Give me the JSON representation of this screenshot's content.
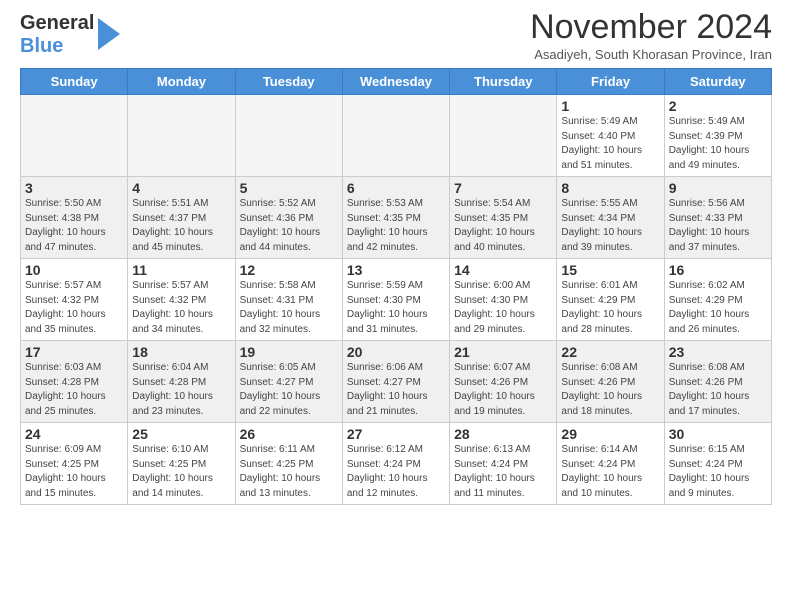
{
  "header": {
    "logo_line1": "General",
    "logo_line2": "Blue",
    "month_title": "November 2024",
    "location": "Asadiyeh, South Khorasan Province, Iran"
  },
  "days_of_week": [
    "Sunday",
    "Monday",
    "Tuesday",
    "Wednesday",
    "Thursday",
    "Friday",
    "Saturday"
  ],
  "weeks": [
    [
      {
        "day": "",
        "info": ""
      },
      {
        "day": "",
        "info": ""
      },
      {
        "day": "",
        "info": ""
      },
      {
        "day": "",
        "info": ""
      },
      {
        "day": "",
        "info": ""
      },
      {
        "day": "1",
        "info": "Sunrise: 5:49 AM\nSunset: 4:40 PM\nDaylight: 10 hours\nand 51 minutes."
      },
      {
        "day": "2",
        "info": "Sunrise: 5:49 AM\nSunset: 4:39 PM\nDaylight: 10 hours\nand 49 minutes."
      }
    ],
    [
      {
        "day": "3",
        "info": "Sunrise: 5:50 AM\nSunset: 4:38 PM\nDaylight: 10 hours\nand 47 minutes."
      },
      {
        "day": "4",
        "info": "Sunrise: 5:51 AM\nSunset: 4:37 PM\nDaylight: 10 hours\nand 45 minutes."
      },
      {
        "day": "5",
        "info": "Sunrise: 5:52 AM\nSunset: 4:36 PM\nDaylight: 10 hours\nand 44 minutes."
      },
      {
        "day": "6",
        "info": "Sunrise: 5:53 AM\nSunset: 4:35 PM\nDaylight: 10 hours\nand 42 minutes."
      },
      {
        "day": "7",
        "info": "Sunrise: 5:54 AM\nSunset: 4:35 PM\nDaylight: 10 hours\nand 40 minutes."
      },
      {
        "day": "8",
        "info": "Sunrise: 5:55 AM\nSunset: 4:34 PM\nDaylight: 10 hours\nand 39 minutes."
      },
      {
        "day": "9",
        "info": "Sunrise: 5:56 AM\nSunset: 4:33 PM\nDaylight: 10 hours\nand 37 minutes."
      }
    ],
    [
      {
        "day": "10",
        "info": "Sunrise: 5:57 AM\nSunset: 4:32 PM\nDaylight: 10 hours\nand 35 minutes."
      },
      {
        "day": "11",
        "info": "Sunrise: 5:57 AM\nSunset: 4:32 PM\nDaylight: 10 hours\nand 34 minutes."
      },
      {
        "day": "12",
        "info": "Sunrise: 5:58 AM\nSunset: 4:31 PM\nDaylight: 10 hours\nand 32 minutes."
      },
      {
        "day": "13",
        "info": "Sunrise: 5:59 AM\nSunset: 4:30 PM\nDaylight: 10 hours\nand 31 minutes."
      },
      {
        "day": "14",
        "info": "Sunrise: 6:00 AM\nSunset: 4:30 PM\nDaylight: 10 hours\nand 29 minutes."
      },
      {
        "day": "15",
        "info": "Sunrise: 6:01 AM\nSunset: 4:29 PM\nDaylight: 10 hours\nand 28 minutes."
      },
      {
        "day": "16",
        "info": "Sunrise: 6:02 AM\nSunset: 4:29 PM\nDaylight: 10 hours\nand 26 minutes."
      }
    ],
    [
      {
        "day": "17",
        "info": "Sunrise: 6:03 AM\nSunset: 4:28 PM\nDaylight: 10 hours\nand 25 minutes."
      },
      {
        "day": "18",
        "info": "Sunrise: 6:04 AM\nSunset: 4:28 PM\nDaylight: 10 hours\nand 23 minutes."
      },
      {
        "day": "19",
        "info": "Sunrise: 6:05 AM\nSunset: 4:27 PM\nDaylight: 10 hours\nand 22 minutes."
      },
      {
        "day": "20",
        "info": "Sunrise: 6:06 AM\nSunset: 4:27 PM\nDaylight: 10 hours\nand 21 minutes."
      },
      {
        "day": "21",
        "info": "Sunrise: 6:07 AM\nSunset: 4:26 PM\nDaylight: 10 hours\nand 19 minutes."
      },
      {
        "day": "22",
        "info": "Sunrise: 6:08 AM\nSunset: 4:26 PM\nDaylight: 10 hours\nand 18 minutes."
      },
      {
        "day": "23",
        "info": "Sunrise: 6:08 AM\nSunset: 4:26 PM\nDaylight: 10 hours\nand 17 minutes."
      }
    ],
    [
      {
        "day": "24",
        "info": "Sunrise: 6:09 AM\nSunset: 4:25 PM\nDaylight: 10 hours\nand 15 minutes."
      },
      {
        "day": "25",
        "info": "Sunrise: 6:10 AM\nSunset: 4:25 PM\nDaylight: 10 hours\nand 14 minutes."
      },
      {
        "day": "26",
        "info": "Sunrise: 6:11 AM\nSunset: 4:25 PM\nDaylight: 10 hours\nand 13 minutes."
      },
      {
        "day": "27",
        "info": "Sunrise: 6:12 AM\nSunset: 4:24 PM\nDaylight: 10 hours\nand 12 minutes."
      },
      {
        "day": "28",
        "info": "Sunrise: 6:13 AM\nSunset: 4:24 PM\nDaylight: 10 hours\nand 11 minutes."
      },
      {
        "day": "29",
        "info": "Sunrise: 6:14 AM\nSunset: 4:24 PM\nDaylight: 10 hours\nand 10 minutes."
      },
      {
        "day": "30",
        "info": "Sunrise: 6:15 AM\nSunset: 4:24 PM\nDaylight: 10 hours\nand 9 minutes."
      }
    ]
  ]
}
